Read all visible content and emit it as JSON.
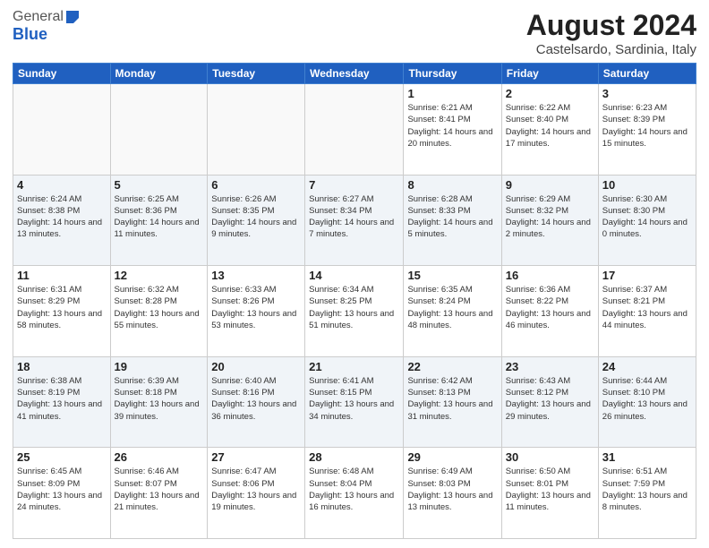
{
  "header": {
    "logo_general": "General",
    "logo_blue": "Blue",
    "title": "August 2024",
    "subtitle": "Castelsardo, Sardinia, Italy"
  },
  "weekdays": [
    "Sunday",
    "Monday",
    "Tuesday",
    "Wednesday",
    "Thursday",
    "Friday",
    "Saturday"
  ],
  "weeks": [
    [
      {
        "day": "",
        "info": ""
      },
      {
        "day": "",
        "info": ""
      },
      {
        "day": "",
        "info": ""
      },
      {
        "day": "",
        "info": ""
      },
      {
        "day": "1",
        "info": "Sunrise: 6:21 AM\nSunset: 8:41 PM\nDaylight: 14 hours\nand 20 minutes."
      },
      {
        "day": "2",
        "info": "Sunrise: 6:22 AM\nSunset: 8:40 PM\nDaylight: 14 hours\nand 17 minutes."
      },
      {
        "day": "3",
        "info": "Sunrise: 6:23 AM\nSunset: 8:39 PM\nDaylight: 14 hours\nand 15 minutes."
      }
    ],
    [
      {
        "day": "4",
        "info": "Sunrise: 6:24 AM\nSunset: 8:38 PM\nDaylight: 14 hours\nand 13 minutes."
      },
      {
        "day": "5",
        "info": "Sunrise: 6:25 AM\nSunset: 8:36 PM\nDaylight: 14 hours\nand 11 minutes."
      },
      {
        "day": "6",
        "info": "Sunrise: 6:26 AM\nSunset: 8:35 PM\nDaylight: 14 hours\nand 9 minutes."
      },
      {
        "day": "7",
        "info": "Sunrise: 6:27 AM\nSunset: 8:34 PM\nDaylight: 14 hours\nand 7 minutes."
      },
      {
        "day": "8",
        "info": "Sunrise: 6:28 AM\nSunset: 8:33 PM\nDaylight: 14 hours\nand 5 minutes."
      },
      {
        "day": "9",
        "info": "Sunrise: 6:29 AM\nSunset: 8:32 PM\nDaylight: 14 hours\nand 2 minutes."
      },
      {
        "day": "10",
        "info": "Sunrise: 6:30 AM\nSunset: 8:30 PM\nDaylight: 14 hours\nand 0 minutes."
      }
    ],
    [
      {
        "day": "11",
        "info": "Sunrise: 6:31 AM\nSunset: 8:29 PM\nDaylight: 13 hours\nand 58 minutes."
      },
      {
        "day": "12",
        "info": "Sunrise: 6:32 AM\nSunset: 8:28 PM\nDaylight: 13 hours\nand 55 minutes."
      },
      {
        "day": "13",
        "info": "Sunrise: 6:33 AM\nSunset: 8:26 PM\nDaylight: 13 hours\nand 53 minutes."
      },
      {
        "day": "14",
        "info": "Sunrise: 6:34 AM\nSunset: 8:25 PM\nDaylight: 13 hours\nand 51 minutes."
      },
      {
        "day": "15",
        "info": "Sunrise: 6:35 AM\nSunset: 8:24 PM\nDaylight: 13 hours\nand 48 minutes."
      },
      {
        "day": "16",
        "info": "Sunrise: 6:36 AM\nSunset: 8:22 PM\nDaylight: 13 hours\nand 46 minutes."
      },
      {
        "day": "17",
        "info": "Sunrise: 6:37 AM\nSunset: 8:21 PM\nDaylight: 13 hours\nand 44 minutes."
      }
    ],
    [
      {
        "day": "18",
        "info": "Sunrise: 6:38 AM\nSunset: 8:19 PM\nDaylight: 13 hours\nand 41 minutes."
      },
      {
        "day": "19",
        "info": "Sunrise: 6:39 AM\nSunset: 8:18 PM\nDaylight: 13 hours\nand 39 minutes."
      },
      {
        "day": "20",
        "info": "Sunrise: 6:40 AM\nSunset: 8:16 PM\nDaylight: 13 hours\nand 36 minutes."
      },
      {
        "day": "21",
        "info": "Sunrise: 6:41 AM\nSunset: 8:15 PM\nDaylight: 13 hours\nand 34 minutes."
      },
      {
        "day": "22",
        "info": "Sunrise: 6:42 AM\nSunset: 8:13 PM\nDaylight: 13 hours\nand 31 minutes."
      },
      {
        "day": "23",
        "info": "Sunrise: 6:43 AM\nSunset: 8:12 PM\nDaylight: 13 hours\nand 29 minutes."
      },
      {
        "day": "24",
        "info": "Sunrise: 6:44 AM\nSunset: 8:10 PM\nDaylight: 13 hours\nand 26 minutes."
      }
    ],
    [
      {
        "day": "25",
        "info": "Sunrise: 6:45 AM\nSunset: 8:09 PM\nDaylight: 13 hours\nand 24 minutes."
      },
      {
        "day": "26",
        "info": "Sunrise: 6:46 AM\nSunset: 8:07 PM\nDaylight: 13 hours\nand 21 minutes."
      },
      {
        "day": "27",
        "info": "Sunrise: 6:47 AM\nSunset: 8:06 PM\nDaylight: 13 hours\nand 19 minutes."
      },
      {
        "day": "28",
        "info": "Sunrise: 6:48 AM\nSunset: 8:04 PM\nDaylight: 13 hours\nand 16 minutes."
      },
      {
        "day": "29",
        "info": "Sunrise: 6:49 AM\nSunset: 8:03 PM\nDaylight: 13 hours\nand 13 minutes."
      },
      {
        "day": "30",
        "info": "Sunrise: 6:50 AM\nSunset: 8:01 PM\nDaylight: 13 hours\nand 11 minutes."
      },
      {
        "day": "31",
        "info": "Sunrise: 6:51 AM\nSunset: 7:59 PM\nDaylight: 13 hours\nand 8 minutes."
      }
    ]
  ]
}
